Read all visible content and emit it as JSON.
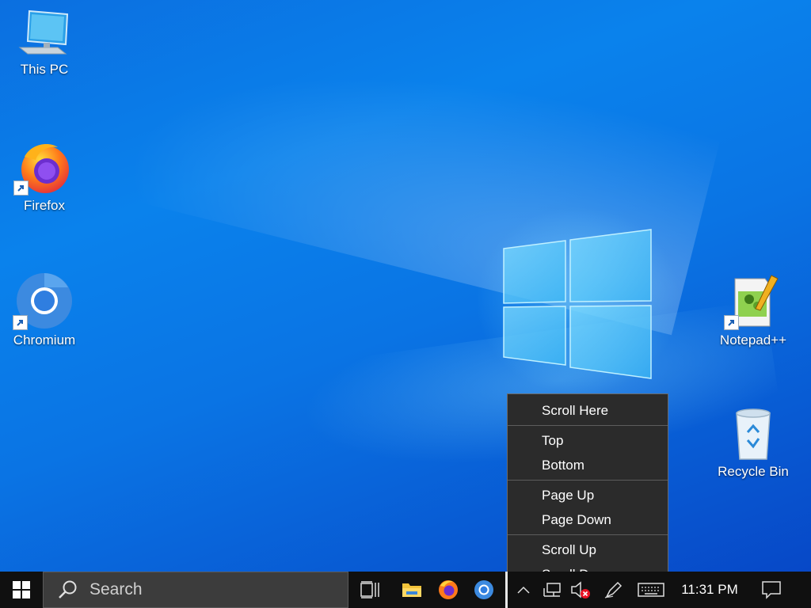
{
  "desktop": {
    "icons": [
      {
        "label": "This PC",
        "icon": "computer-icon"
      },
      {
        "label": "Firefox",
        "icon": "firefox-icon"
      },
      {
        "label": "Chromium",
        "icon": "chromium-icon"
      },
      {
        "label": "Notepad++",
        "icon": "notepadpp-icon"
      },
      {
        "label": "Recycle Bin",
        "icon": "recycle-bin-icon"
      }
    ]
  },
  "context_menu": {
    "items": [
      "Scroll Here",
      "Top",
      "Bottom",
      "Page Up",
      "Page Down",
      "Scroll Up",
      "Scroll Down"
    ]
  },
  "taskbar": {
    "search_placeholder": "Search",
    "clock": "11:31 PM",
    "pinned": [
      "task-view-icon",
      "file-explorer-icon",
      "firefox-icon",
      "chromium-icon"
    ],
    "tray": [
      "chevron-up-icon",
      "network-icon",
      "volume-muted-icon",
      "pen-icon",
      "keyboard-icon",
      "notification-icon"
    ]
  },
  "colors": {
    "menu_bg": "#2b2b2b",
    "taskbar_bg": "#101010",
    "desktop_accent": "#0a78e6"
  }
}
